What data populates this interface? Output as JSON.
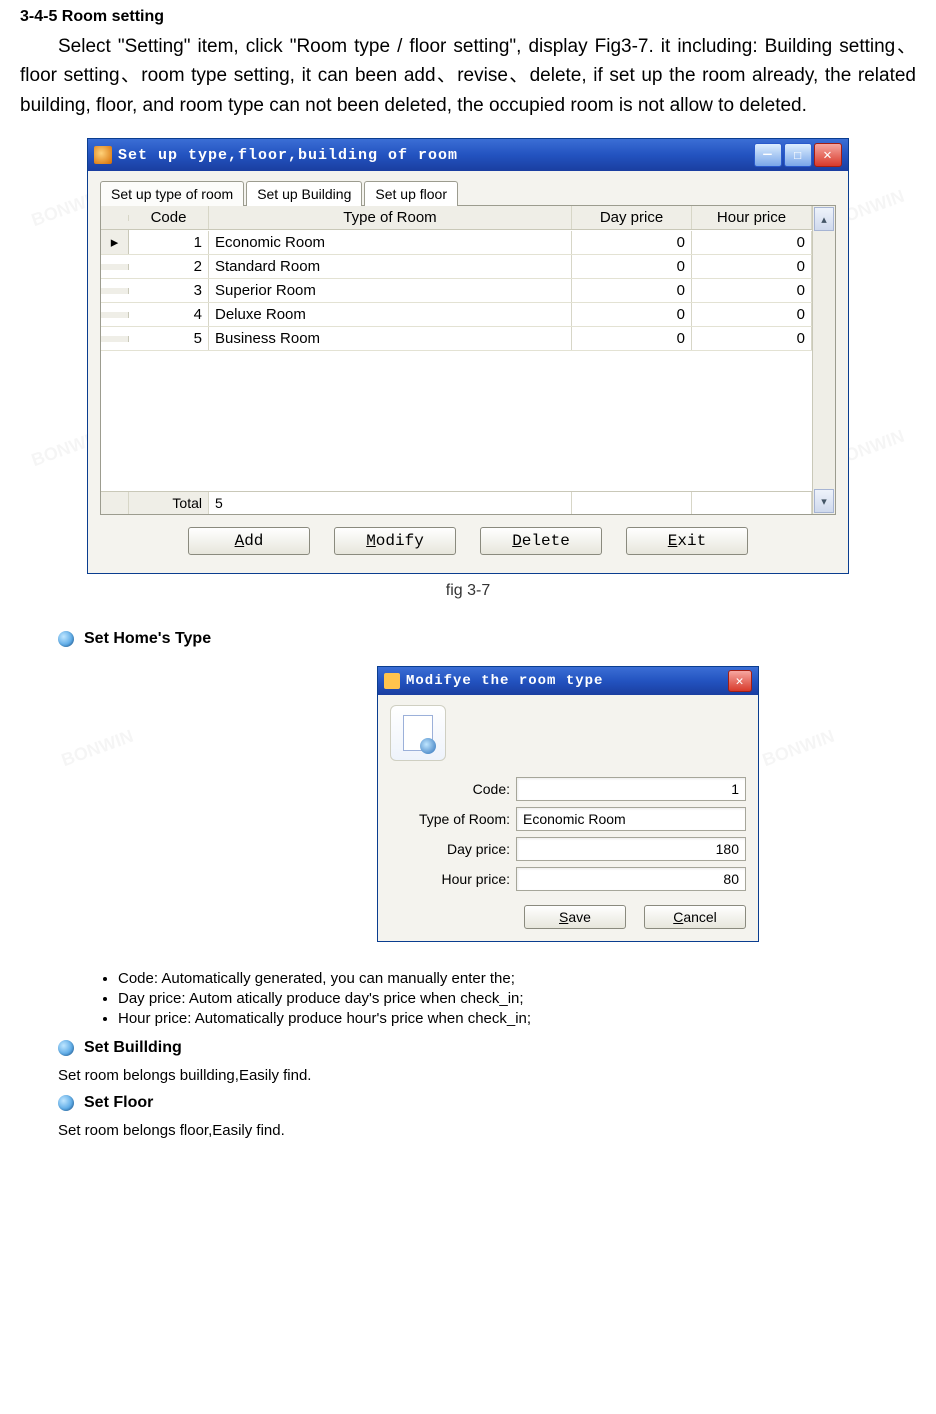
{
  "heading": "3-4-5    Room setting",
  "paragraph": "Select \"Setting\" item, click \"Room type / floor setting\", display Fig3-7. it including: Building setting、floor setting、room type setting, it can been add、revise、delete, if set up the room already, the related building, floor, and room type can not been deleted, the occupied room is not allow to deleted.",
  "window": {
    "title": "Set up type,floor,building of room",
    "tabs": [
      "Set up type of room",
      "Set up Building",
      "Set up floor"
    ],
    "columns": [
      "Code",
      "Type of Room",
      "Day price",
      "Hour price"
    ],
    "rows": [
      {
        "code": "1",
        "room": "Economic Room",
        "day": "0",
        "hour": "0"
      },
      {
        "code": "2",
        "room": "Standard Room",
        "day": "0",
        "hour": "0"
      },
      {
        "code": "3",
        "room": "Superior Room",
        "day": "0",
        "hour": "0"
      },
      {
        "code": "4",
        "room": "Deluxe Room",
        "day": "0",
        "hour": "0"
      },
      {
        "code": "5",
        "room": "Business Room",
        "day": "0",
        "hour": "0"
      }
    ],
    "total_label": "Total",
    "total_value": "5",
    "buttons": {
      "add": "Add",
      "modify": "Modify",
      "delete": "Delete",
      "exit": "Exit"
    },
    "hotkeys": {
      "add": "A",
      "modify": "M",
      "delete": "D",
      "exit": "E"
    }
  },
  "fig_caption": "fig 3-7",
  "section_set_type": "Set Home's Type",
  "dialog": {
    "title": "Modifye the room type",
    "fields": {
      "code_label": "Code:",
      "code_value": "1",
      "type_label": "Type of Room:",
      "type_value": "Economic Room",
      "day_label": "Day price:",
      "day_value": "180",
      "hour_label": "Hour price:",
      "hour_value": "80"
    },
    "buttons": {
      "save": "Save",
      "cancel": "Cancel"
    },
    "hotkeys": {
      "save": "S",
      "cancel": "C"
    }
  },
  "notes": [
    "Code: Automatically generated, you can manually enter the;",
    "Day price: Autom atically produce day's price when check_in;",
    "Hour price: Automatically produce hour's price when check_in;"
  ],
  "section_building": "Set Buillding",
  "section_building_sub": "Set room belongs buillding,Easily find.",
  "section_floor": "Set Floor",
  "section_floor_sub": "Set room belongs floor,Easily find."
}
